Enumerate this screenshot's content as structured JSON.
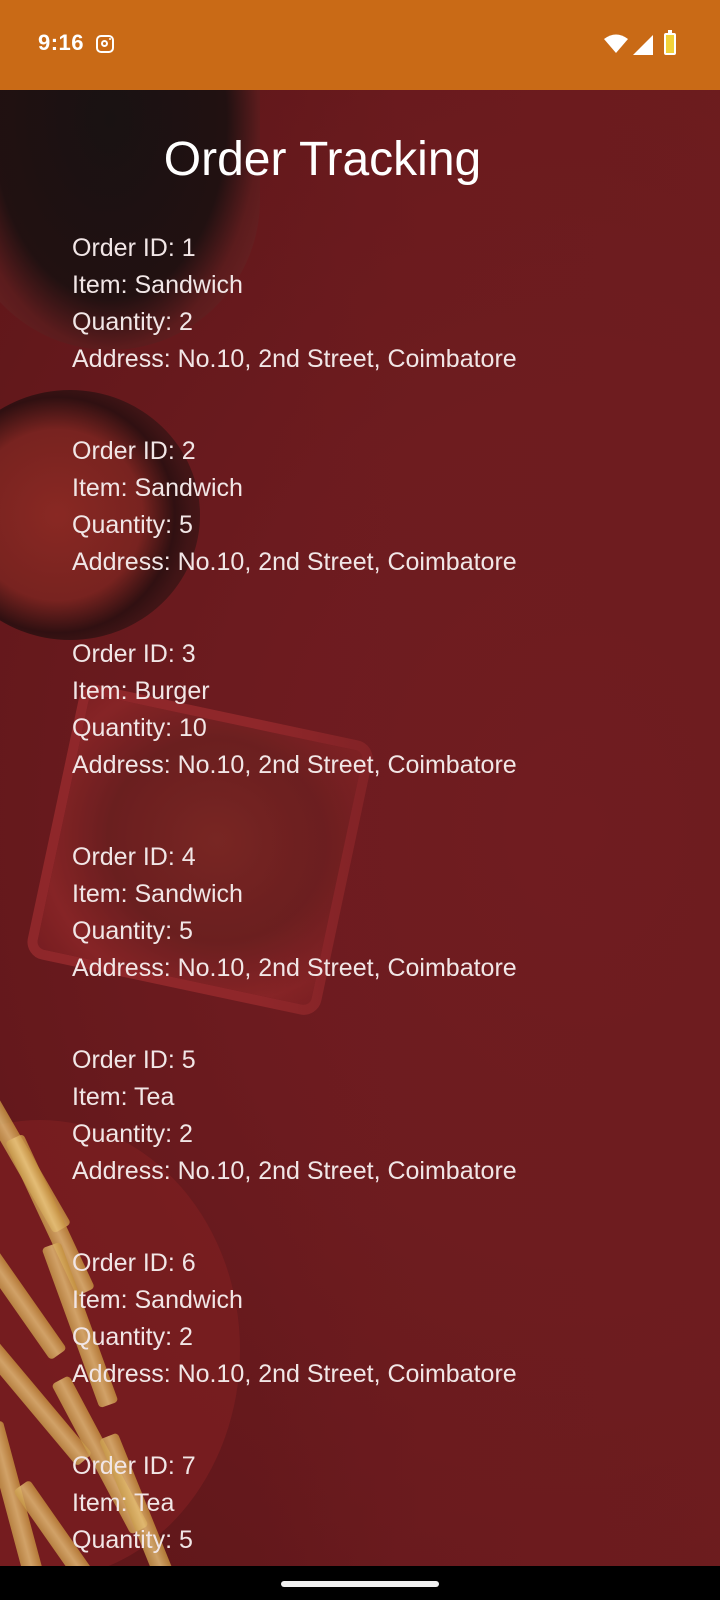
{
  "status_bar": {
    "time": "9:16",
    "icons": [
      "instagram-icon",
      "wifi-icon",
      "signal-icon",
      "battery-icon"
    ],
    "color": "#c96a16"
  },
  "page": {
    "title": "Order Tracking",
    "background_color": "#6f1d1f"
  },
  "orders": [
    {
      "id": "Order ID: 1",
      "item": "Item: Sandwich",
      "quantity": "Quantity: 2",
      "address": "Address: No.10, 2nd Street, Coimbatore"
    },
    {
      "id": "Order ID: 2",
      "item": "Item: Sandwich",
      "quantity": "Quantity: 5",
      "address": "Address: No.10, 2nd Street, Coimbatore"
    },
    {
      "id": "Order ID: 3",
      "item": "Item: Burger",
      "quantity": "Quantity: 10",
      "address": "Address: No.10, 2nd Street, Coimbatore"
    },
    {
      "id": "Order ID: 4",
      "item": "Item: Sandwich",
      "quantity": "Quantity: 5",
      "address": "Address: No.10, 2nd Street, Coimbatore"
    },
    {
      "id": "Order ID: 5",
      "item": "Item: Tea",
      "quantity": "Quantity: 2",
      "address": "Address: No.10, 2nd Street, Coimbatore"
    },
    {
      "id": "Order ID: 6",
      "item": "Item: Sandwich",
      "quantity": "Quantity: 2",
      "address": "Address: No.10, 2nd Street, Coimbatore"
    },
    {
      "id": "Order ID: 7",
      "item": "Item: Tea",
      "quantity": "Quantity: 5",
      "address": ""
    }
  ]
}
